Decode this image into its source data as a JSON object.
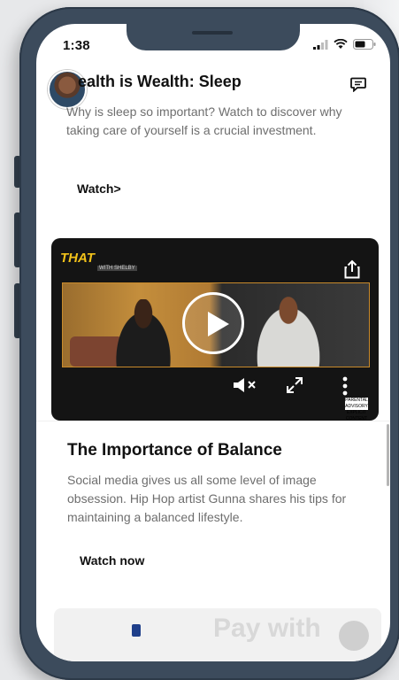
{
  "status_bar": {
    "time": "1:38"
  },
  "post1": {
    "title": "ealth is Wealth: Sleep",
    "description": "Why is sleep so important? Watch to discover why taking care of yourself is a crucial investment.",
    "action_label": "Watch>"
  },
  "video": {
    "logo_text": "THAT",
    "logo_sub": "WITH SHELBY",
    "explicit_label": "PARENTAL ADVISORY EXPLICIT CONTENT"
  },
  "post2": {
    "title": "The Importance of Balance",
    "description": "Social media gives us all some level of image obsession. Hip Hop artist Gunna shares his tips for maintaining a balanced lifestyle.",
    "action_label": "Watch now"
  },
  "next_card": {
    "partial_title": "Pay with"
  },
  "icons": {
    "signal": "cellular-signal-icon",
    "wifi": "wifi-icon",
    "battery": "battery-icon",
    "message": "message-icon",
    "share": "share-icon",
    "play": "play-icon",
    "mute": "mute-icon",
    "fullscreen": "fullscreen-icon",
    "more": "more-vertical-icon"
  },
  "colors": {
    "frame": "#3c4b5c",
    "accent_gold": "#f2c21a"
  }
}
